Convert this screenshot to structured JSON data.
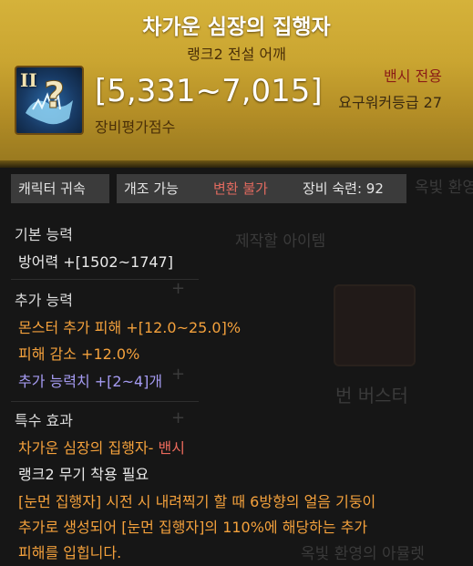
{
  "item": {
    "name": "차가운 심장의 집행자",
    "subtitle": "랭크2 전설 어깨",
    "rank_mark": "II",
    "score_range": "[5,331~7,015]",
    "score_label": "장비평가점수",
    "class_restriction": "밴시 전용",
    "required_level": "요구워커등급 27"
  },
  "tags": [
    "캐릭터 귀속",
    "개조 가능",
    "변환 불가",
    "장비 숙련: 92"
  ],
  "sections": {
    "basic_title": "기본 능력",
    "basic_line": "방어력  +[1502~1747]",
    "extra_title": "추가 능력",
    "extra_line1": "몬스터 추가 피해  +[12.0~25.0]%",
    "extra_line2": "피해 감소  +12.0%",
    "extra_line3": "추가 능력치 +[2~4]개",
    "special_title": "특수 효과",
    "special_name": "차가운 심장의 집행자-",
    "special_class": " 밴시",
    "special_req": "랭크2 무기 착용 필요",
    "special_desc1": "[눈먼 집행자] 시전 시 내려찍기 할 때 6방향의 얼음 기둥이",
    "special_desc2": "추가로 생성되어 [눈먼 집행자]의 110%에 해당하는 추가",
    "special_desc3": "피해를 입힙니다."
  },
  "background": {
    "crafting_label": "제작할 아이템",
    "item_name": "번 버스터",
    "other_item": "옥빛 환영의 아뮬렛",
    "side_text": "옥빛 환영"
  },
  "colors": {
    "header_gold": "#caa531",
    "class_red": "#8b1d16",
    "effect_orange": "#f4a13c",
    "stat_violet": "#a59bf2"
  }
}
